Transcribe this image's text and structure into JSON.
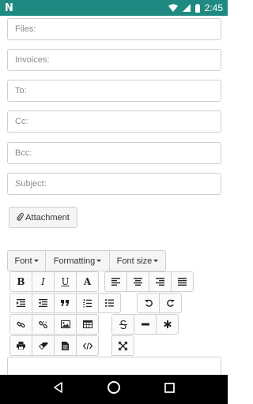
{
  "status_bar": {
    "logo": "N",
    "time": "2:45"
  },
  "form": {
    "files_placeholder": "Files:",
    "invoices_placeholder": "Invoices:",
    "to_placeholder": "To:",
    "cc_placeholder": "Cc:",
    "bcc_placeholder": "Bcc:",
    "subject_placeholder": "Subject:",
    "attachment_label": "Attachment"
  },
  "toolbar": {
    "font_label": "Font",
    "formatting_label": "Formatting",
    "font_size_label": "Font size",
    "bold_label": "B",
    "italic_label": "I",
    "underline_label": "U",
    "font_color_label": "A"
  }
}
